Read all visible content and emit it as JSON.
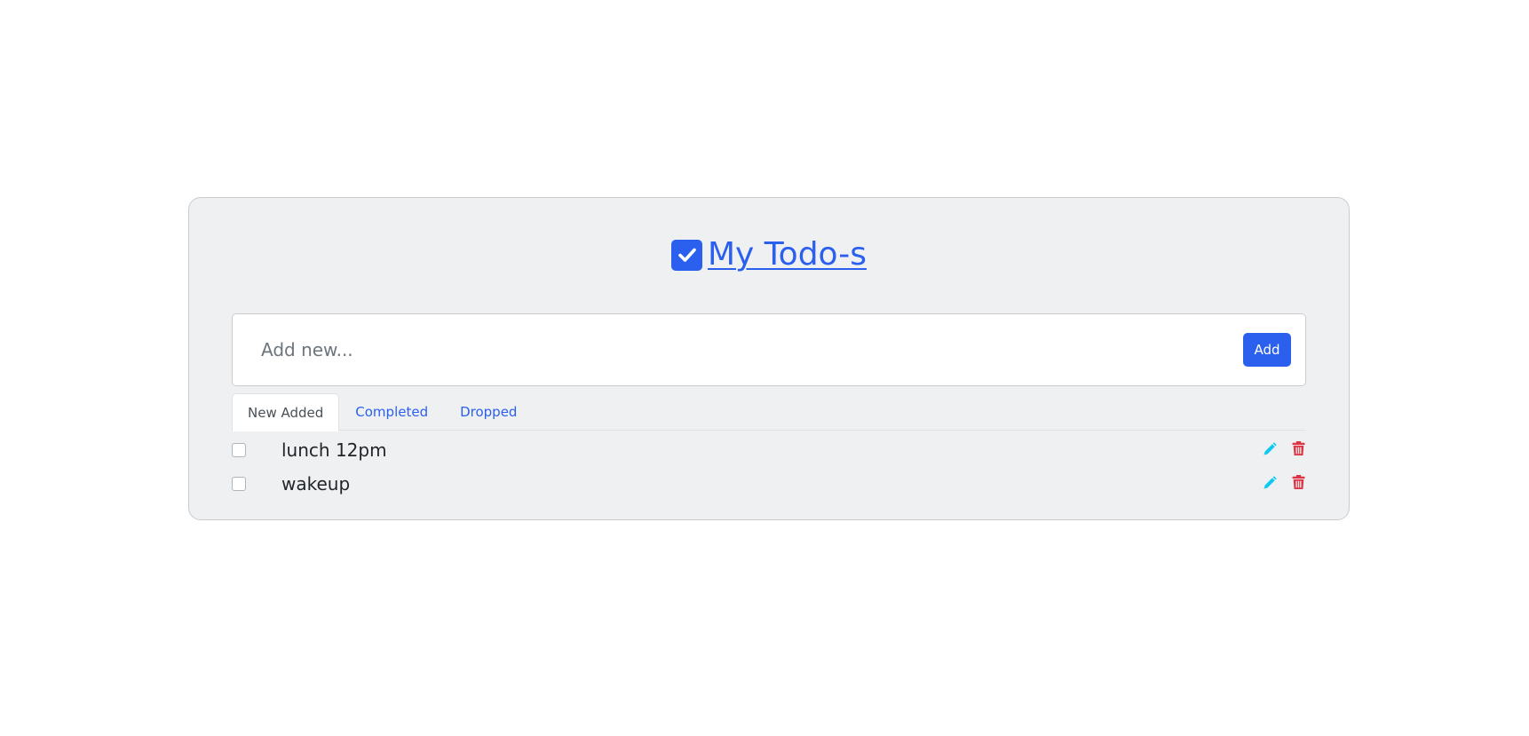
{
  "header": {
    "title": "My Todo-s",
    "title_icon": "check-square-icon",
    "accent_color": "#2b60ef"
  },
  "add_form": {
    "placeholder": "Add new...",
    "value": "",
    "button_label": "Add"
  },
  "tabs": [
    {
      "label": "New Added",
      "active": true
    },
    {
      "label": "Completed",
      "active": false
    },
    {
      "label": "Dropped",
      "active": false
    }
  ],
  "todos": [
    {
      "text": "lunch 12pm",
      "checked": false,
      "edit_icon": "pencil-icon",
      "delete_icon": "trash-icon"
    },
    {
      "text": "wakeup",
      "checked": false,
      "edit_icon": "pencil-icon",
      "delete_icon": "trash-icon"
    }
  ],
  "colors": {
    "edit_icon": "#0dcaf0",
    "delete_icon": "#dc3545"
  }
}
